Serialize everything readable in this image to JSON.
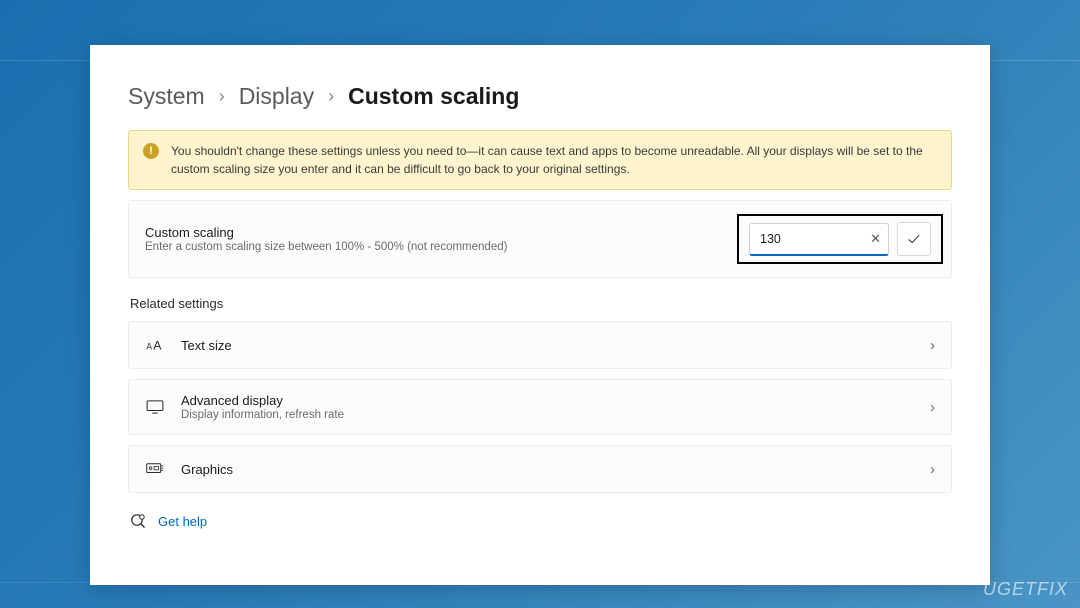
{
  "breadcrumb": {
    "system": "System",
    "display": "Display",
    "current": "Custom scaling"
  },
  "warning": {
    "text": "You shouldn't change these settings unless you need to—it can cause text and apps to become unreadable. All your displays will be set to the custom scaling size you enter and it can be difficult to go back to your original settings."
  },
  "custom_scaling": {
    "title": "Custom scaling",
    "subtitle": "Enter a custom scaling size between 100% - 500% (not recommended)",
    "value": "130"
  },
  "related": {
    "header": "Related settings",
    "text_size": {
      "title": "Text size"
    },
    "advanced_display": {
      "title": "Advanced display",
      "subtitle": "Display information, refresh rate"
    },
    "graphics": {
      "title": "Graphics"
    }
  },
  "help": {
    "label": "Get help"
  },
  "watermark": "UGETFIX"
}
